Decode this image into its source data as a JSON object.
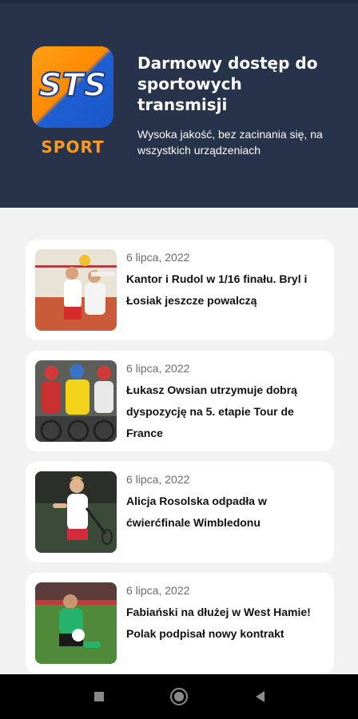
{
  "header": {
    "logo_text": "STS",
    "logo_label": "SPORT",
    "title": "Darmowy dostęp do sportowych transmisji",
    "subtitle": "Wysoka jakość, bez zacinania się, na wszystkich urządzeniach"
  },
  "articles": [
    {
      "date": "6 lipca, 2022",
      "title": "Kantor i Rudol w 1/16 finału. Bryl i Łosiak jeszcze powalczą"
    },
    {
      "date": "6 lipca, 2022",
      "title": "Łukasz Owsian utrzymuje dobrą dyspozycję na 5. etapie Tour de France"
    },
    {
      "date": "6 lipca, 2022",
      "title": "Alicja Rosolska odpadła w ćwierćfinale Wimbledonu"
    },
    {
      "date": "6 lipca, 2022",
      "title": "Fabiański na dłużej w West Hamie! Polak podpisał nowy kontrakt"
    }
  ],
  "icons": {
    "nav_recents": "square-icon",
    "nav_home": "circle-icon",
    "nav_back": "triangle-back-icon"
  },
  "colors": {
    "header_bg": "#27324b",
    "brand_orange": "#ff9a1a",
    "brand_blue": "#1a57c7"
  }
}
